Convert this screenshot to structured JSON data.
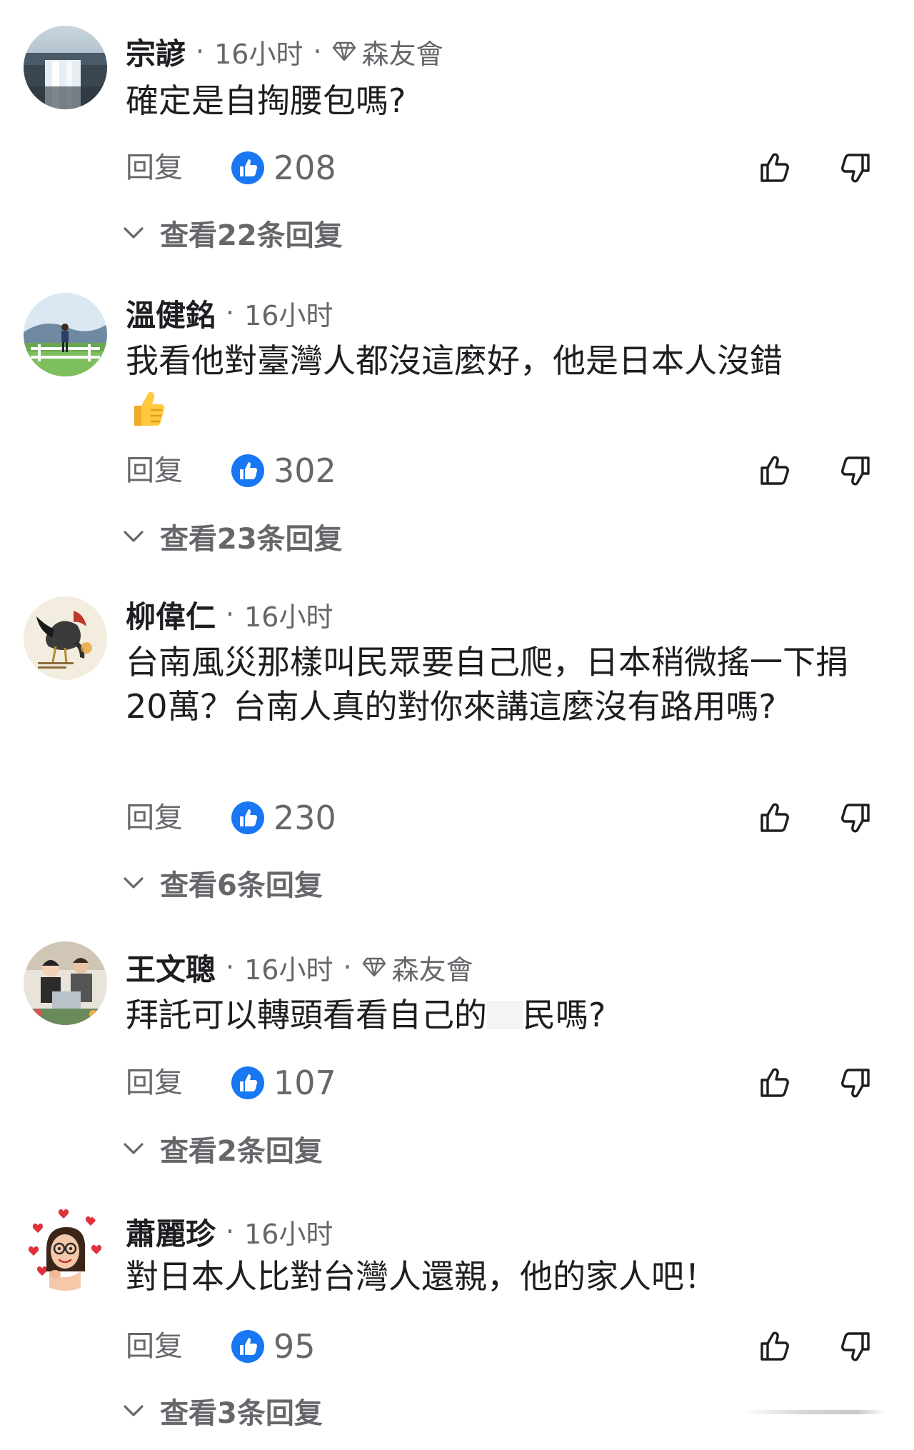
{
  "comments": [
    {
      "author": "宗諺",
      "time": "16小时",
      "badge": "森友會",
      "text": "確定是自掏腰包嗎?",
      "reply_label": "回复",
      "likes": "208",
      "view_replies": "查看22条回复",
      "avatar": "waterfall-photo"
    },
    {
      "author": "溫健銘",
      "time": "16小时",
      "badge": "",
      "text": "我看他對臺灣人都沒這麼好，他是日本人沒錯",
      "emoji": "thumbs-up-emoji",
      "reply_label": "回复",
      "likes": "302",
      "view_replies": "查看23条回复",
      "avatar": "person-in-field-photo"
    },
    {
      "author": "柳偉仁",
      "time": "16小时",
      "badge": "",
      "text": "台南風災那樣叫民眾要自己爬，日本稍微搖一下捐20萬？台南人真的對你來講這麼沒有路用嗎?",
      "reply_label": "回复",
      "likes": "230",
      "view_replies": "查看6条回复",
      "avatar": "rooster-painting"
    },
    {
      "author": "王文聰",
      "time": "16小时",
      "badge": "森友會",
      "text_before": "拜託可以轉頭看看自己的",
      "text_after": "民嗎?",
      "reply_label": "回复",
      "likes": "107",
      "view_replies": "查看2条回复",
      "avatar": "family-photo"
    },
    {
      "author": "蕭麗珍",
      "time": "16小时",
      "badge": "",
      "text": "對日本人比對台灣人還親，他的家人吧！",
      "reply_label": "回复",
      "likes": "95",
      "view_replies": "查看3条回复",
      "avatar": "cartoon-woman-hearts"
    }
  ],
  "colors": {
    "like_blue": "#1877f2",
    "secondary_text": "#65676b",
    "primary_text": "#1c1e21"
  }
}
